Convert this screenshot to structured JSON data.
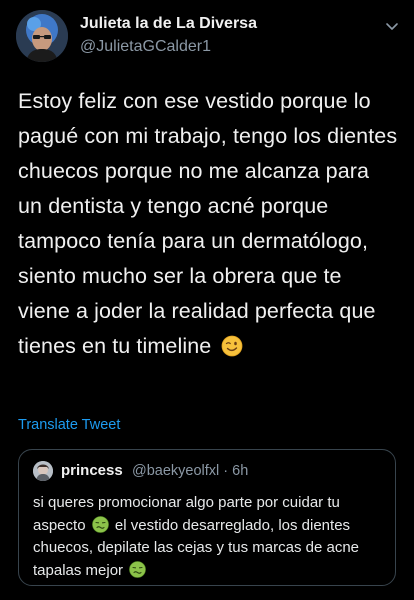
{
  "author": {
    "display_name": "Julieta la de La Diversa",
    "handle": "@JulietaGCalder1"
  },
  "tweet": {
    "text": "Estoy feliz con ese vestido porque lo pagué con mi trabajo, tengo los dientes chuecos porque no me alcanza para un dentista y tengo acné porque tampoco tenía para un dermatólogo, siento mucho ser la obrera que te viene a joder la realidad perfecta que tienes en tu timeline",
    "trailing_emoji": "wink-face-emoji",
    "translate_label": "Translate Tweet"
  },
  "quoted_tweet": {
    "display_name": "princess",
    "meta": "@baekyeolfxl · 6h",
    "text_part1": "si queres promocionar algo parte por cuidar tu aspecto",
    "text_part2": "el vestido desarreglado, los dientes chuecos, depilate las cejas y tus marcas de acne tapalas mejor",
    "emoji": "nauseated-face-emoji"
  },
  "colors": {
    "background": "#000000",
    "link": "#1d9bf0",
    "secondary_text": "#8b98a5",
    "border": "#38444d"
  },
  "icons": {
    "menu": "chevron-down-icon"
  }
}
